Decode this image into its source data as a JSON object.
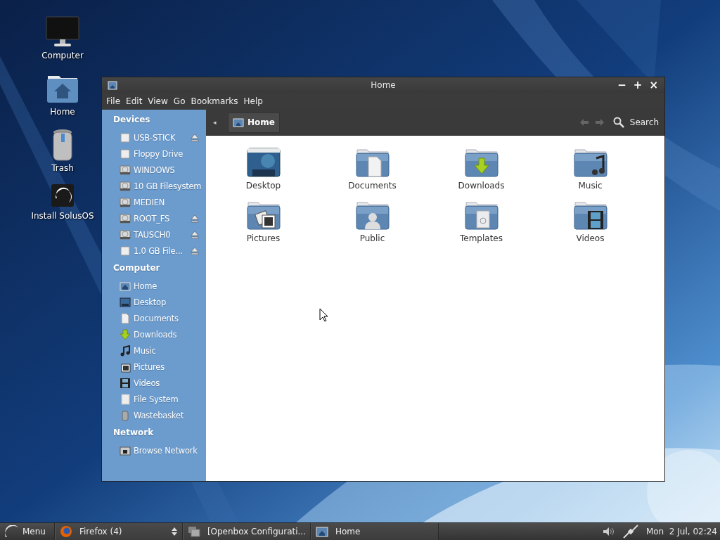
{
  "desktop_icons": [
    {
      "label": "Computer",
      "kind": "monitor"
    },
    {
      "label": "Home",
      "kind": "home"
    },
    {
      "label": "Trash",
      "kind": "trash"
    },
    {
      "label": "Install SolusOS",
      "kind": "installer"
    }
  ],
  "window": {
    "title": "Home",
    "controls": [
      "−",
      "+",
      "×"
    ],
    "menu": [
      "File",
      "Edit",
      "View",
      "Go",
      "Bookmarks",
      "Help"
    ],
    "sidebar": {
      "sections": [
        {
          "title": "Devices",
          "items": [
            {
              "label": "USB-STICK",
              "kind": "removable",
              "eject": true
            },
            {
              "label": "Floppy Drive",
              "kind": "removable",
              "eject": false
            },
            {
              "label": "WINDOWS",
              "kind": "drive",
              "eject": false
            },
            {
              "label": "10 GB Filesystem",
              "kind": "drive",
              "eject": false
            },
            {
              "label": "MEDIEN",
              "kind": "drive",
              "eject": false
            },
            {
              "label": "ROOT_FS",
              "kind": "drive",
              "eject": true
            },
            {
              "label": "TAUSCH0",
              "kind": "drive",
              "eject": true
            },
            {
              "label": "1.0 GB File...",
              "kind": "removable",
              "eject": true
            }
          ]
        },
        {
          "title": "Computer",
          "items": [
            {
              "label": "Home",
              "kind": "home",
              "eject": false
            },
            {
              "label": "Desktop",
              "kind": "desktop",
              "eject": false
            },
            {
              "label": "Documents",
              "kind": "documents",
              "eject": false
            },
            {
              "label": "Downloads",
              "kind": "downloads",
              "eject": false
            },
            {
              "label": "Music",
              "kind": "music",
              "eject": false
            },
            {
              "label": "Pictures",
              "kind": "pictures",
              "eject": false
            },
            {
              "label": "Videos",
              "kind": "videos",
              "eject": false
            },
            {
              "label": "File System",
              "kind": "filesystem",
              "eject": false
            },
            {
              "label": "Wastebasket",
              "kind": "trash",
              "eject": false
            }
          ]
        },
        {
          "title": "Network",
          "items": [
            {
              "label": "Browse Network",
              "kind": "network",
              "eject": false
            }
          ]
        }
      ]
    },
    "toolbar": {
      "back_arrow": "◂",
      "path": [
        {
          "label": "Home",
          "selected": true
        }
      ],
      "search_label": "Search"
    },
    "files": [
      {
        "label": "Desktop",
        "kind": "desktop"
      },
      {
        "label": "Documents",
        "kind": "documents"
      },
      {
        "label": "Downloads",
        "kind": "downloads"
      },
      {
        "label": "Music",
        "kind": "music"
      },
      {
        "label": "Pictures",
        "kind": "pictures"
      },
      {
        "label": "Public",
        "kind": "public"
      },
      {
        "label": "Templates",
        "kind": "templates"
      },
      {
        "label": "Videos",
        "kind": "videos"
      }
    ]
  },
  "taskbar": {
    "menu_label": "Menu",
    "tasks": [
      {
        "label": "Firefox (4)",
        "kind": "firefox"
      },
      {
        "label": "[Openbox Configurati...",
        "kind": "windows"
      },
      {
        "label": "Home",
        "kind": "folder"
      }
    ],
    "clock": "Mon  2 Jul, 02:24"
  }
}
